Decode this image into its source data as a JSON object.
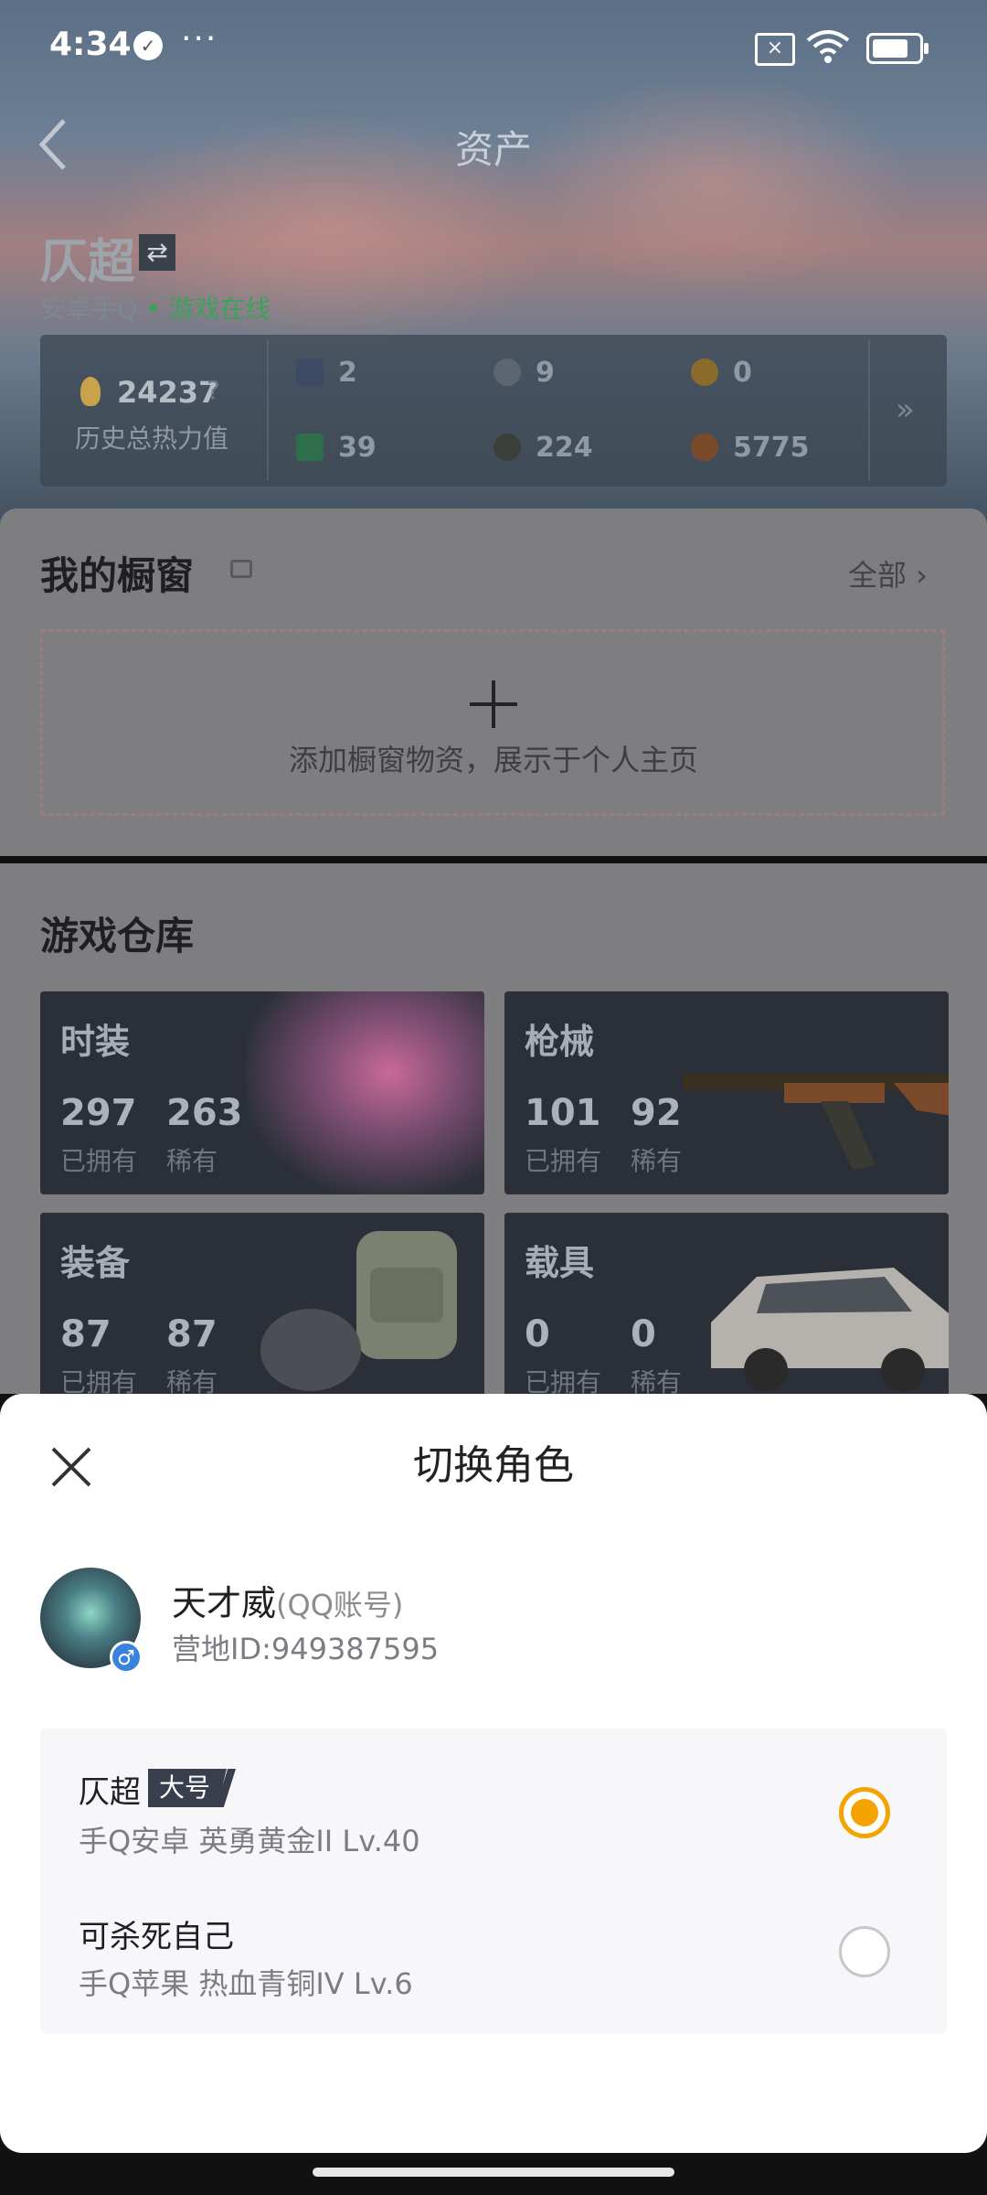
{
  "status_bar": {
    "time": "4:34",
    "dots": "···",
    "battery_level": 0.8
  },
  "header": {
    "title": "资产",
    "back_icon": "chevron-left-icon"
  },
  "player": {
    "name": "仄超",
    "platform": "安卓手Q",
    "online_status": "• 游戏在线"
  },
  "stats": {
    "heat_value": "24237",
    "heat_question": "?",
    "heat_label": "历史总热力值",
    "items": [
      {
        "icon": "card-dark-icon",
        "value": "2",
        "color": "#3d4a63"
      },
      {
        "icon": "coin-gray-icon",
        "value": "9",
        "color": "#5d6670"
      },
      {
        "icon": "coin-gold-icon",
        "value": "0",
        "color": "#8a6b2c"
      },
      {
        "icon": "card-green-icon",
        "value": "39",
        "color": "#2f6e4a"
      },
      {
        "icon": "ball-dark-icon",
        "value": "224",
        "color": "#3a3f3a"
      },
      {
        "icon": "coin-bronze-icon",
        "value": "5775",
        "color": "#7a4a2a"
      }
    ],
    "more": "»"
  },
  "showcase": {
    "title": "我的橱窗",
    "all_label": "全部 ›",
    "hint": "添加橱窗物资，展示于个人主页"
  },
  "warehouse": {
    "title": "游戏仓库",
    "cards": [
      {
        "title": "时装",
        "owned": "297",
        "owned_label": "已拥有",
        "rare": "263",
        "rare_label": "稀有"
      },
      {
        "title": "枪械",
        "owned": "101",
        "owned_label": "已拥有",
        "rare": "92",
        "rare_label": "稀有"
      },
      {
        "title": "装备",
        "owned": "87",
        "owned_label": "已拥有",
        "rare": "87",
        "rare_label": "稀有"
      },
      {
        "title": "载具",
        "owned": "0",
        "owned_label": "已拥有",
        "rare": "0",
        "rare_label": "稀有"
      }
    ]
  },
  "sheet": {
    "title": "切换角色",
    "account": {
      "name": "天才威",
      "type": "(QQ账号)",
      "camp_id": "营地ID:949387595",
      "gender": "♂"
    },
    "roles": [
      {
        "name": "仄超",
        "tag": "大号",
        "detail": "手Q安卓  英勇黄金II  Lv.40",
        "selected": true
      },
      {
        "name": "可杀死自己",
        "tag": "",
        "detail": "手Q苹果  热血青铜IV  Lv.6",
        "selected": false
      }
    ]
  }
}
